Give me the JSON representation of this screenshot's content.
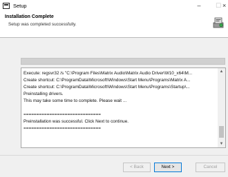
{
  "window": {
    "title": "Setup",
    "controls": {
      "minimize": "–",
      "maximize": "☐",
      "close": "×"
    }
  },
  "header": {
    "title": "Installation Complete",
    "subtitle": "Setup was completed successfully."
  },
  "progress": {
    "value": 1.0
  },
  "log": {
    "lines": [
      "Execute: regsvr32 /s \"C:\\Program Files\\Matrix Audio\\Matrix Audio Driver\\W10_x64\\M...",
      "Create shortcut: C:\\ProgramData\\Microsoft\\Windows\\Start Menu\\Programs\\Matrix A...",
      "Create shortcut: C:\\ProgramData\\Microsoft\\Windows\\Start Menu\\Programs\\Startup\\...",
      "Preinstalling drivers.",
      "This may take some time to complete. Please wait ...",
      "",
      "==============================",
      "Preinstallation was successful. Click Next to continue.",
      "=============================="
    ]
  },
  "buttons": {
    "back": "< Back",
    "next": "Next >",
    "cancel": "Cancel"
  }
}
